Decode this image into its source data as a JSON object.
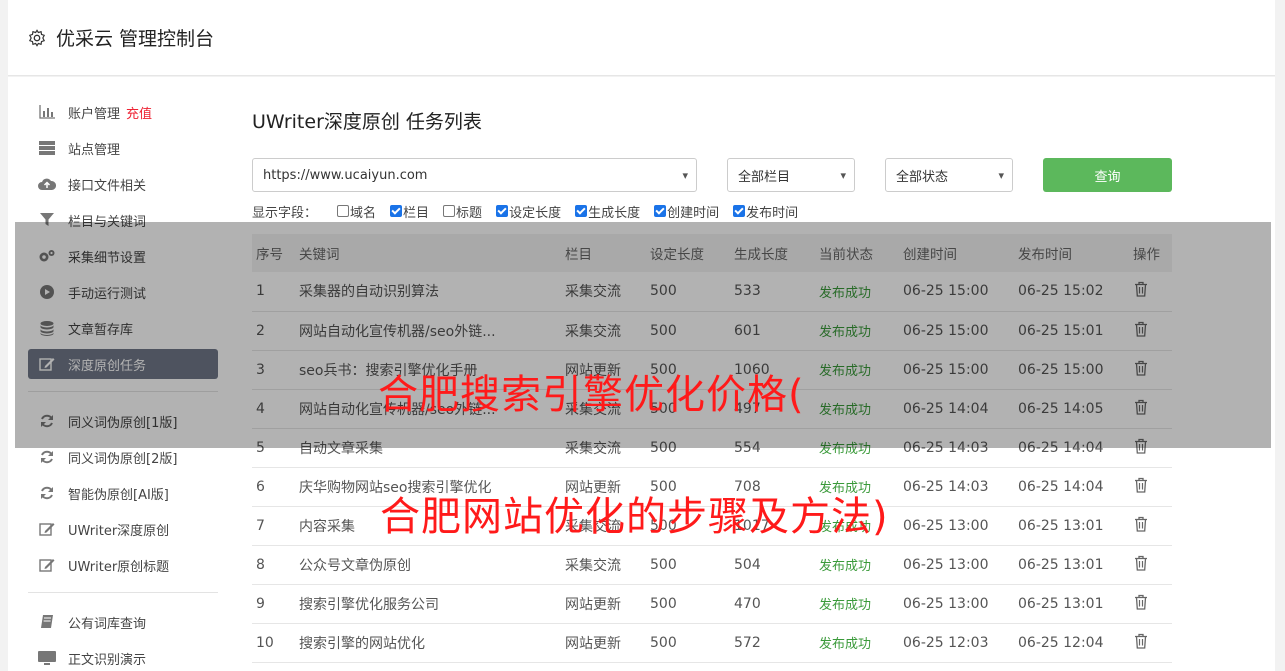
{
  "header": {
    "title": "优采云 管理控制台"
  },
  "sidebar": {
    "items": [
      {
        "label": "账户管理",
        "extra": "充值",
        "icon": "bar-chart-icon"
      },
      {
        "label": "站点管理",
        "icon": "server-icon"
      },
      {
        "label": "接口文件相关",
        "icon": "cloud-upload-icon"
      },
      {
        "label": "栏目与关键词",
        "icon": "filter-icon"
      },
      {
        "label": "采集细节设置",
        "icon": "gears-icon"
      },
      {
        "label": "手动运行测试",
        "icon": "play-icon"
      },
      {
        "label": "文章暂存库",
        "icon": "database-icon"
      },
      {
        "label": "深度原创任务",
        "icon": "edit-icon"
      }
    ],
    "items2": [
      {
        "label": "同义词伪原创[1版]",
        "icon": "refresh-icon"
      },
      {
        "label": "同义词伪原创[2版]",
        "icon": "refresh-icon"
      },
      {
        "label": "智能伪原创[AI版]",
        "icon": "refresh-icon"
      },
      {
        "label": "UWriter深度原创",
        "icon": "edit-icon"
      },
      {
        "label": "UWriter原创标题",
        "icon": "edit-icon"
      }
    ],
    "items3": [
      {
        "label": "公有词库查询",
        "icon": "book-icon"
      },
      {
        "label": "正文识别演示",
        "icon": "monitor-icon"
      }
    ]
  },
  "main": {
    "title": "UWriter深度原创 任务列表",
    "site_select": "https://www.ucaiyun.com",
    "column_select": "全部栏目",
    "status_select": "全部状态",
    "query_label": "查询",
    "fields_label": "显示字段：",
    "fields": [
      {
        "label": "域名",
        "checked": false
      },
      {
        "label": "栏目",
        "checked": true
      },
      {
        "label": "标题",
        "checked": false
      },
      {
        "label": "设定长度",
        "checked": true
      },
      {
        "label": "生成长度",
        "checked": true
      },
      {
        "label": "创建时间",
        "checked": true
      },
      {
        "label": "发布时间",
        "checked": true
      }
    ]
  },
  "table": {
    "headers": [
      "序号",
      "关键词",
      "栏目",
      "设定长度",
      "生成长度",
      "当前状态",
      "创建时间",
      "发布时间",
      "操作"
    ],
    "rows": [
      [
        "1",
        "采集器的自动识别算法",
        "采集交流",
        "500",
        "533",
        "发布成功",
        "06-25 15:00",
        "06-25 15:02"
      ],
      [
        "2",
        "网站自动化宣传机器/seo外链...",
        "采集交流",
        "500",
        "601",
        "发布成功",
        "06-25 15:00",
        "06-25 15:01"
      ],
      [
        "3",
        "seo兵书：搜索引擎优化手册",
        "网站更新",
        "500",
        "1060",
        "发布成功",
        "06-25 15:00",
        "06-25 15:00"
      ],
      [
        "4",
        "网站自动化宣传机器/seo外链...",
        "采集交流",
        "500",
        "497",
        "发布成功",
        "06-25 14:04",
        "06-25 14:05"
      ],
      [
        "5",
        "自动文章采集",
        "采集交流",
        "500",
        "554",
        "发布成功",
        "06-25 14:03",
        "06-25 14:04"
      ],
      [
        "6",
        "庆华购物网站seo搜索引擎优化",
        "网站更新",
        "500",
        "708",
        "发布成功",
        "06-25 14:03",
        "06-25 14:04"
      ],
      [
        "7",
        "内容采集",
        "采集交流",
        "500",
        "1017",
        "发布成功",
        "06-25 13:00",
        "06-25 13:01"
      ],
      [
        "8",
        "公众号文章伪原创",
        "采集交流",
        "500",
        "504",
        "发布成功",
        "06-25 13:00",
        "06-25 13:01"
      ],
      [
        "9",
        "搜索引擎优化服务公司",
        "网站更新",
        "500",
        "470",
        "发布成功",
        "06-25 13:00",
        "06-25 13:01"
      ],
      [
        "10",
        "搜索引擎的网站优化",
        "网站更新",
        "500",
        "572",
        "发布成功",
        "06-25 12:03",
        "06-25 12:04"
      ]
    ]
  },
  "overlay": {
    "line1": "合肥搜索引擎优化价格(",
    "line2": "合肥网站优化的步骤及方法)"
  }
}
